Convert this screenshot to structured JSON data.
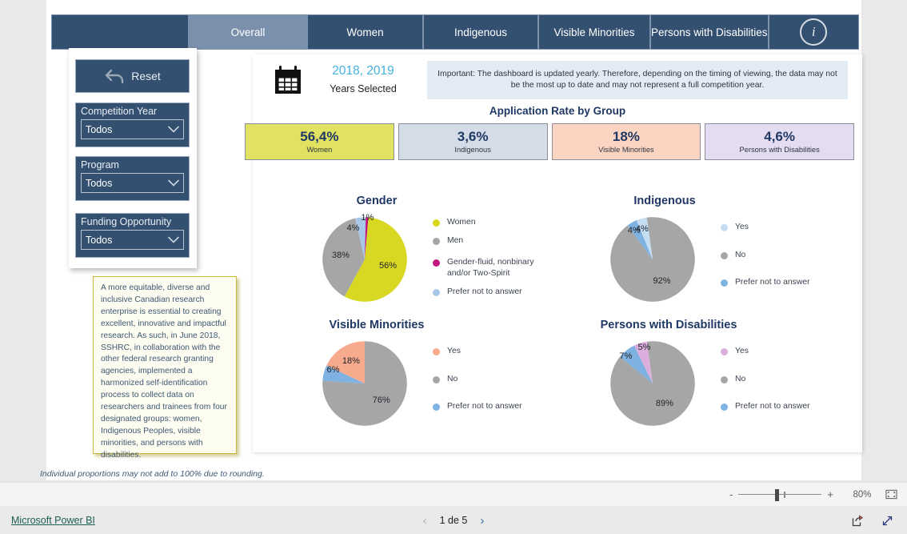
{
  "tabs": [
    {
      "label": "",
      "name": "tab-blank",
      "active": false
    },
    {
      "label": "Overall",
      "name": "tab-overall",
      "active": true
    },
    {
      "label": "Women",
      "name": "tab-women",
      "active": false
    },
    {
      "label": "Indigenous",
      "name": "tab-indigenous",
      "active": false
    },
    {
      "label": "Visible Minorities",
      "name": "tab-visible-minorities",
      "active": false
    },
    {
      "label": "Persons with Disabilities",
      "name": "tab-persons-with-disabilities",
      "active": false
    }
  ],
  "info_icon_label": "i",
  "filters": {
    "reset_label": "Reset",
    "slicers": [
      {
        "title": "Competition Year",
        "value": "Todos"
      },
      {
        "title": "Program",
        "value": "Todos"
      },
      {
        "title": "Funding Opportunity",
        "value": "Todos"
      }
    ]
  },
  "note": {
    "text": "A more equitable, diverse and inclusive Canadian research enterprise is essential to creating excellent, innovative and impactful research. As such, in June 2018, SSHRC, in collaboration with the other federal research granting agencies, implemented a harmonized self-identification process to collect data on researchers and trainees from four designated groups: women, Indigenous Peoples, visible minorities, and persons with disabilities."
  },
  "header": {
    "years_value": "2018, 2019",
    "years_label": "Years Selected",
    "notice": "Important: The dashboard is updated yearly. Therefore, depending on the timing of viewing, the data may not be the most up to date and may not represent a full competition year.",
    "section_title": "Application Rate by Group"
  },
  "kpis": [
    {
      "value": "56,4%",
      "label": "Women",
      "color": "#e2e262"
    },
    {
      "value": "3,6%",
      "label": "Indigenous",
      "color": "#d3dce7"
    },
    {
      "value": "18%",
      "label": "Visible Minorities",
      "color": "#fbd5c2"
    },
    {
      "value": "4,6%",
      "label": "Persons with Disabilities",
      "color": "#e4dcf0"
    }
  ],
  "footnote": "Individual proportions may not add to 100% due to rounding.",
  "chart_data": [
    {
      "type": "pie",
      "title": "Gender",
      "labels": [
        "Women",
        "Men",
        "Gender-fluid, nonbinary and/or Two-Spirit",
        "Prefer not to answer"
      ],
      "values": [
        56,
        38,
        1,
        4
      ],
      "display_labels": [
        "56%",
        "38%",
        "1%",
        "4%"
      ],
      "colors": [
        "#d8d822",
        "#a6a6a6",
        "#c0187e",
        "#a8c8e8"
      ],
      "legend_position": "right"
    },
    {
      "type": "pie",
      "title": "Indigenous",
      "labels": [
        "Yes",
        "No",
        "Prefer not to answer"
      ],
      "values": [
        4,
        92,
        4
      ],
      "display_labels": [
        "4%",
        "92%",
        "4%"
      ],
      "colors": [
        "#c5ddf2",
        "#a6a6a6",
        "#7fb2e0"
      ],
      "legend_position": "right"
    },
    {
      "type": "pie",
      "title": "Visible Minorities",
      "labels": [
        "Yes",
        "No",
        "Prefer not to answer"
      ],
      "values": [
        18,
        76,
        6
      ],
      "display_labels": [
        "18%",
        "76%",
        "6%"
      ],
      "colors": [
        "#f7aa8d",
        "#a6a6a6",
        "#7fb2e0"
      ],
      "legend_position": "right"
    },
    {
      "type": "pie",
      "title": "Persons with Disabilities",
      "labels": [
        "Yes",
        "No",
        "Prefer not to answer"
      ],
      "values": [
        5,
        89,
        7
      ],
      "display_labels": [
        "5%",
        "89%",
        "7%"
      ],
      "colors": [
        "#dbaede",
        "#a6a6a6",
        "#7fb2e0"
      ],
      "legend_position": "right"
    }
  ],
  "zoombar": {
    "minus": "-",
    "plus": "+",
    "zoom_level": "80%"
  },
  "footer": {
    "brand": "Microsoft Power BI",
    "page_indicator": "1 de 5",
    "prev": "‹",
    "next": "›"
  }
}
